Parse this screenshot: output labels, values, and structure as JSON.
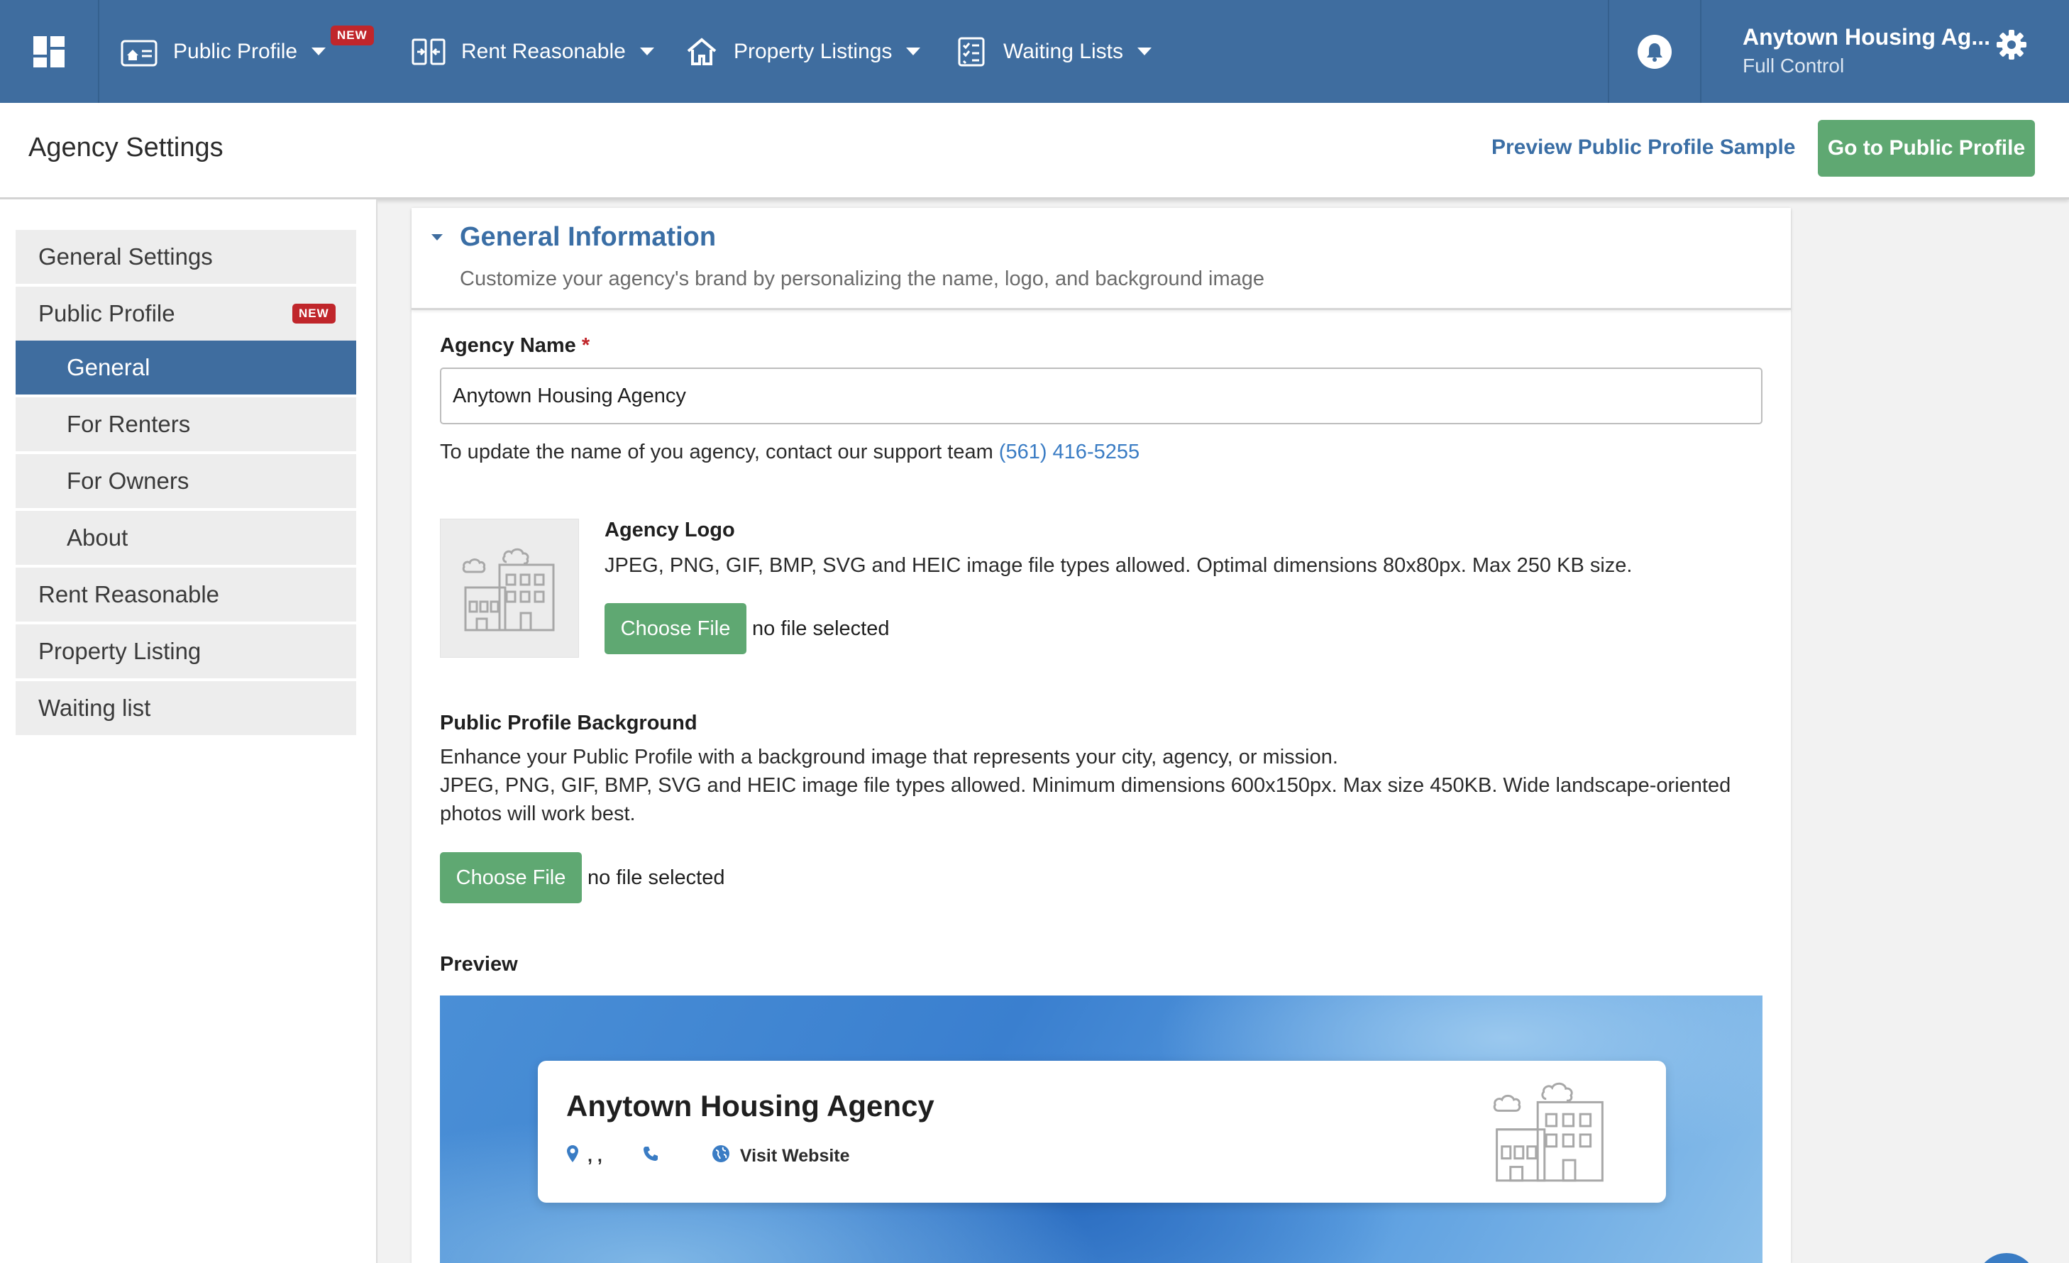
{
  "topbar": {
    "dashboard_icon": "dashboard-grid-icon",
    "nav": [
      {
        "label": "Public Profile",
        "icon": "profile-card-icon",
        "badge": "NEW"
      },
      {
        "label": "Rent Reasonable",
        "icon": "compare-icon"
      },
      {
        "label": "Property Listings",
        "icon": "home-icon"
      },
      {
        "label": "Waiting Lists",
        "icon": "checklist-icon"
      }
    ],
    "bell_icon": "bell-icon",
    "user": {
      "name": "Anytown Housing Ag...",
      "role": "Full Control"
    },
    "gear_icon": "gear-icon"
  },
  "header": {
    "title": "Agency Settings",
    "preview_link": "Preview Public Profile Sample",
    "go_button": "Go to Public Profile"
  },
  "sidebar": {
    "items": [
      {
        "label": "General Settings"
      },
      {
        "label": "Public Profile",
        "badge": "NEW"
      },
      {
        "label": "General",
        "active": true
      },
      {
        "label": "For Renters"
      },
      {
        "label": "For Owners"
      },
      {
        "label": "About"
      },
      {
        "label": "Rent Reasonable"
      },
      {
        "label": "Property Listing"
      },
      {
        "label": "Waiting list"
      }
    ]
  },
  "section": {
    "title": "General Information",
    "subtitle": "Customize your agency's brand by personalizing the name, logo, and background image"
  },
  "agency_name": {
    "label": "Agency Name",
    "required_mark": "*",
    "value": "Anytown Housing Agency",
    "help": "To update the name of you agency, contact our support team",
    "phone": "(561) 416-5255"
  },
  "agency_logo": {
    "label": "Agency Logo",
    "desc": "JPEG, PNG, GIF, BMP, SVG and HEIC image file types allowed. Optimal dimensions 80x80px. Max 250 KB size.",
    "button": "Choose File",
    "status": "no file selected"
  },
  "background": {
    "label": "Public Profile Background",
    "desc1": "Enhance your Public Profile with a background image that represents your city, agency, or mission.",
    "desc2": "JPEG, PNG, GIF, BMP, SVG and HEIC image file types allowed. Minimum dimensions 600x150px. Max size 450KB. Wide landscape-oriented",
    "desc3": "photos will work best.",
    "button": "Choose File",
    "status": "no file selected"
  },
  "preview": {
    "label": "Preview",
    "agency_name": "Anytown Housing Agency",
    "address": ", ,",
    "website": "Visit Website"
  },
  "colors": {
    "topbar": "#3f6d9f",
    "accent_green": "#5fa872",
    "link_blue": "#3a6ea5",
    "badge_red": "#c0262b"
  }
}
